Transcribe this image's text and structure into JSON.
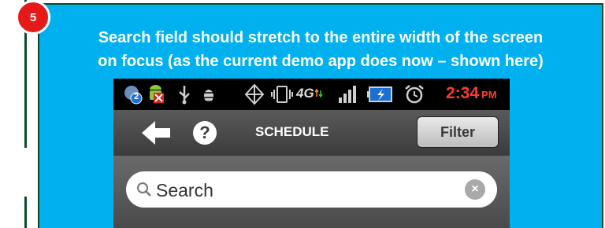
{
  "slide": {
    "step_number": "5",
    "caption_line1": "Search field should stretch to the entire width of the screen",
    "caption_line2": "on focus (as the current demo app does now – shown here)",
    "colors": {
      "background": "#00b0ef",
      "border": "#0e4a2a",
      "badge": "#e61919",
      "text": "#ffffff"
    }
  },
  "phone": {
    "status_bar": {
      "icons": [
        "notification-count-icon",
        "android-error-icon",
        "usb-icon",
        "debug-icon",
        "sync-icon",
        "vibrate-icon",
        "4g-icon",
        "signal-icon",
        "battery-charging-icon",
        "alarm-icon"
      ],
      "notification_count": "2",
      "network_label": "4G",
      "time": "2:34",
      "ampm": "PM",
      "time_color": "#ff3b2f"
    },
    "action_bar": {
      "back_icon": "back-arrow-icon",
      "help_label": "?",
      "title": "SCHEDULE",
      "filter_label": "Filter"
    },
    "search": {
      "placeholder": "Search",
      "search_icon": "magnifier-icon",
      "clear_label": "×"
    }
  }
}
